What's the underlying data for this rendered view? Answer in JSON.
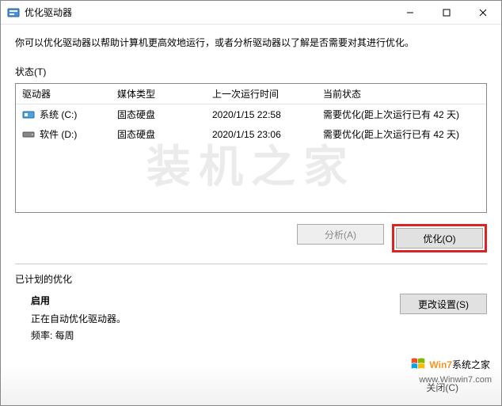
{
  "titlebar": {
    "title": "优化驱动器"
  },
  "description": "你可以优化驱动器以帮助计算机更高效地运行，或者分析驱动器以了解是否需要对其进行优化。",
  "status_label": "状态(T)",
  "columns": {
    "drive": "驱动器",
    "media": "媒体类型",
    "last": "上一次运行时间",
    "state": "当前状态"
  },
  "rows": [
    {
      "name": "系统 (C:)",
      "media": "固态硬盘",
      "last": "2020/1/15 22:58",
      "state": "需要优化(距上次运行已有 42 天)",
      "icon": "system"
    },
    {
      "name": "软件 (D:)",
      "media": "固态硬盘",
      "last": "2020/1/15 23:06",
      "state": "需要优化(距上次运行已有 42 天)",
      "icon": "hdd"
    }
  ],
  "buttons": {
    "analyze": "分析(A)",
    "optimize": "优化(O)",
    "change": "更改设置(S)",
    "close": "关闭(C)"
  },
  "schedule": {
    "title": "已计划的优化",
    "enable": "启用",
    "line1": "正在自动优化驱动器。",
    "freq": "频率: 每周"
  },
  "watermark_text": "装机之家",
  "logo": {
    "brand_colored": "Win7",
    "brand_tail": "系统之家",
    "url": "www.Winwin7.com"
  }
}
